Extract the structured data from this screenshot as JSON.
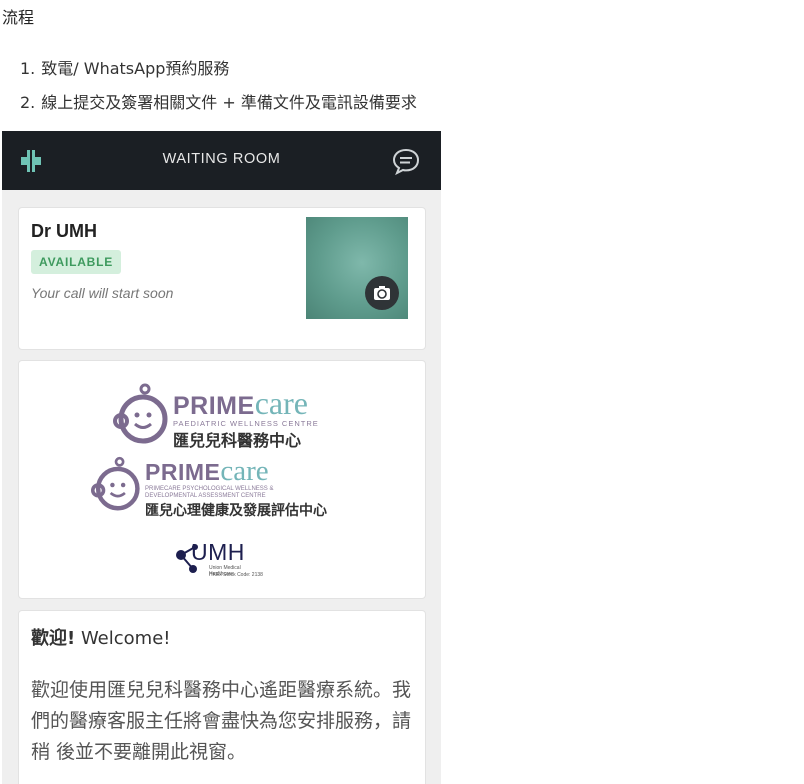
{
  "page": {
    "heading": "流程",
    "steps": [
      {
        "num": "1.",
        "text": "致電/ WhatsApp預約服務"
      },
      {
        "num": "2.",
        "text": "線上提交及簽署相關文件 + 準備文件及電訊設備要求"
      }
    ]
  },
  "app": {
    "title": "WAITING ROOM",
    "logo_icon": "cross-logo-icon",
    "chat_icon": "chat-bubble-icon",
    "doctor": {
      "name": "Dr UMH",
      "badge": "AVAILABLE",
      "status": "Your call will start soon",
      "camera_icon": "camera-switch-icon"
    },
    "logos": {
      "primecare1": {
        "brand_bold": "PRIME",
        "brand_script": "care",
        "subtitle": "PAEDIATRIC WELLNESS CENTRE",
        "cn": "匯兒兒科醫務中心"
      },
      "primecare2": {
        "brand_bold": "PRIME",
        "brand_script": "care",
        "subtitle1": "PRIMECARE PSYCHOLOGICAL WELLNESS &",
        "subtitle2": "DEVELOPMENTAL ASSESSMENT CENTRE",
        "cn": "匯兒心理健康及發展評估中心"
      },
      "umh": {
        "name": "UMH",
        "sub1": "Union Medical Healthcare",
        "sub2": "HKEx Stock Code: 2138"
      }
    },
    "welcome": {
      "title_cn": "歡迎!",
      "title_en": " Welcome!",
      "body": "歡迎使用匯兒兒科醫務中心遙距醫療系統。我們的醫療客服主任將會盡快為您安排服務，請稍 後並不要離開此視窗。"
    }
  },
  "colors": {
    "topbar": "#1b1f24",
    "accent_teal": "#74b5b8",
    "brand_purple": "#7c6b8f",
    "badge_bg": "#d4efdd",
    "badge_text": "#3e9a5e"
  }
}
